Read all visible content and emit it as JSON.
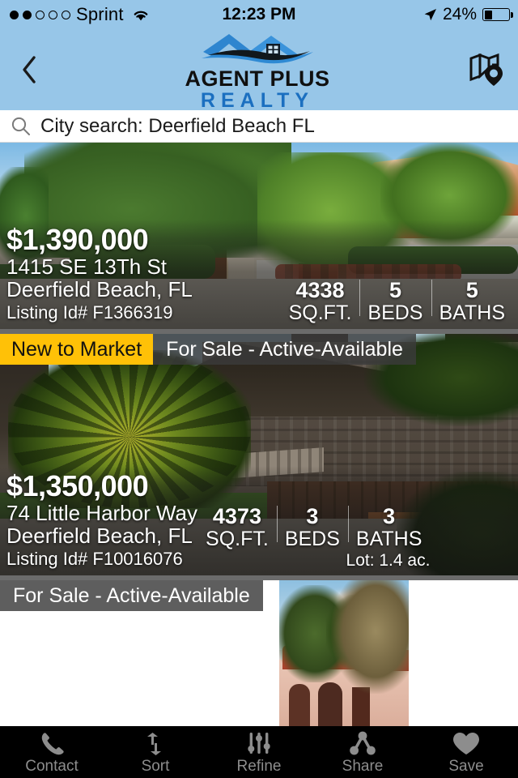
{
  "statusbar": {
    "carrier": "Sprint",
    "signal_dots_filled": 2,
    "signal_dots_total": 5,
    "wifi_icon": "wifi-icon",
    "time": "12:23 PM",
    "location_icon": "location-arrow-icon",
    "battery_percent": "24%",
    "battery_level": 24
  },
  "header": {
    "back_icon": "chevron-left-icon",
    "logo_name": "AGENT PLUS",
    "logo_subtitle": "REALTY",
    "logo_mark_icon": "house-roof-logo-icon",
    "map_icon": "map-pin-icon",
    "background_color": "#97c6e8"
  },
  "search": {
    "icon": "search-icon",
    "value": "City search: Deerfield Beach FL",
    "placeholder": "City search"
  },
  "listings": [
    {
      "price": "$1,390,000",
      "address_line1": "1415 SE 13Th St",
      "address_line2": "Deerfield Beach, FL",
      "listing_id": "Listing Id# F1366319",
      "sqft_value": "4338",
      "sqft_label": "SQ.FT.",
      "beds_value": "5",
      "beds_label": "BEDS",
      "baths_value": "5",
      "baths_label": "BATHS",
      "lot": "",
      "badge_new": "",
      "badge_status": ""
    },
    {
      "price": "$1,350,000",
      "address_line1": "74 Little Harbor Way",
      "address_line2": "Deerfield Beach, FL",
      "listing_id": "Listing Id# F10016076",
      "sqft_value": "4373",
      "sqft_label": "SQ.FT.",
      "beds_value": "3",
      "beds_label": "BEDS",
      "baths_value": "3",
      "baths_label": "BATHS",
      "lot": "Lot: 1.4 ac.",
      "badge_new": "New to Market",
      "badge_status": "For Sale - Active-Available"
    },
    {
      "price": "",
      "address_line1": "",
      "address_line2": "",
      "listing_id": "",
      "sqft_value": "",
      "sqft_label": "",
      "beds_value": "",
      "beds_label": "",
      "baths_value": "",
      "baths_label": "",
      "lot": "",
      "badge_new": "",
      "badge_status": "For Sale - Active-Available"
    }
  ],
  "tabbar": {
    "items": [
      {
        "label": "Contact",
        "icon": "phone-icon"
      },
      {
        "label": "Sort",
        "icon": "sort-arrows-icon"
      },
      {
        "label": "Refine",
        "icon": "sliders-icon"
      },
      {
        "label": "Share",
        "icon": "share-nodes-icon"
      },
      {
        "label": "Save",
        "icon": "heart-icon"
      }
    ],
    "background_color": "#000000",
    "icon_color": "#8d8d8d"
  },
  "colors": {
    "header_blue": "#97c6e8",
    "badge_yellow": "#ffc107",
    "logo_blue": "#1b6fc0",
    "banner_gray": "rgba(58,58,58,.82)"
  }
}
